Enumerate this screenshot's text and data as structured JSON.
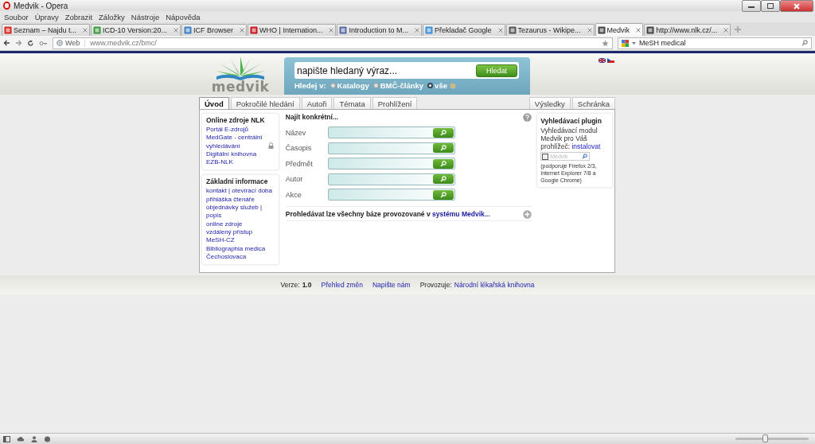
{
  "window": {
    "title": "Medvik - Opera"
  },
  "menu": [
    "Soubor",
    "Úpravy",
    "Zobrazit",
    "Záložky",
    "Nástroje",
    "Nápověda"
  ],
  "browser_tabs": [
    {
      "label": "Seznam – Najdu t...",
      "selected": false
    },
    {
      "label": "ICD-10 Version:20...",
      "selected": false
    },
    {
      "label": "ICF Browser",
      "selected": false
    },
    {
      "label": "WHO | Internation...",
      "selected": false
    },
    {
      "label": "Introduction to M...",
      "selected": false
    },
    {
      "label": "Překladač Google",
      "selected": false
    },
    {
      "label": "Tezaurus - Wikipe...",
      "selected": false
    },
    {
      "label": "Medvik",
      "selected": true
    },
    {
      "label": "http://www.nlk.cz/...",
      "selected": false
    }
  ],
  "address_bar": {
    "prefix": "Web",
    "url": "www.medvik.cz/bmc/"
  },
  "search_engine": {
    "value": "MeSH medical"
  },
  "site": {
    "logo": "medvik",
    "search": {
      "placeholder": "napište hledaný výraz...",
      "button": "Hledat",
      "scope_label": "Hledej v:",
      "scopes": [
        {
          "label": "Katalogy",
          "selected": false
        },
        {
          "label": "BMČ-články",
          "selected": false
        },
        {
          "label": "vše",
          "selected": true
        }
      ]
    },
    "tabs_left": [
      {
        "label": "Úvod",
        "selected": true
      },
      {
        "label": "Pokročilé hledání",
        "selected": false
      },
      {
        "label": "Autoři",
        "selected": false
      },
      {
        "label": "Témata",
        "selected": false
      },
      {
        "label": "Prohlížení",
        "selected": false
      }
    ],
    "tabs_right": [
      {
        "label": "Výsledky",
        "selected": false
      },
      {
        "label": "Schránka",
        "selected": false
      }
    ],
    "sidebar": [
      {
        "title": "Online zdroje NLK",
        "items": [
          {
            "text": "Portál E-zdrojů",
            "locked": false
          },
          {
            "text": "MedGate - centrální vyhledávání",
            "locked": true
          },
          {
            "text": "Digitální knihovna",
            "locked": false
          },
          {
            "text": "EZB-NLK",
            "locked": false
          }
        ]
      },
      {
        "title": "Základní informace",
        "items": [
          {
            "text": "kontakt | otevírací doba",
            "locked": false
          },
          {
            "text": "přihláška čtenáře",
            "locked": false
          },
          {
            "text": "objednávky služeb | popis",
            "locked": false
          },
          {
            "text": "online zdroje",
            "locked": false
          },
          {
            "text": "vzdálený přístup",
            "locked": false
          },
          {
            "text": "MeSH-CZ",
            "locked": false
          },
          {
            "text": "Bibliographia medica Čechoslovaca",
            "locked": false
          }
        ]
      }
    ],
    "find": {
      "heading": "Najít konkrétní...",
      "fields": [
        {
          "label": "Název"
        },
        {
          "label": "Časopis"
        },
        {
          "label": "Předmět"
        },
        {
          "label": "Autor"
        },
        {
          "label": "Akce"
        }
      ],
      "note": "Prohledávat lze všechny báze provozované v",
      "note_link": "systému Medvik..."
    },
    "plugin": {
      "title": "Vyhledávací plugin",
      "text": "Vyhledávací modul Medvik pro Váš prohlížeč:",
      "link": "instalovat",
      "sample_placeholder": "Medvik",
      "support": "(podporuje Firefox 2/3, Internet Explorer 7/8 a Google Chrome)"
    },
    "footer": {
      "version_label": "Verze:",
      "version": "1.0",
      "links": [
        "Přehled změn",
        "Napište nám"
      ],
      "operator_label": "Provozuje:",
      "operator": "Národní lékařská knihovna"
    }
  },
  "status_bar": {
    "zoom": {
      "level": 0.4
    }
  }
}
